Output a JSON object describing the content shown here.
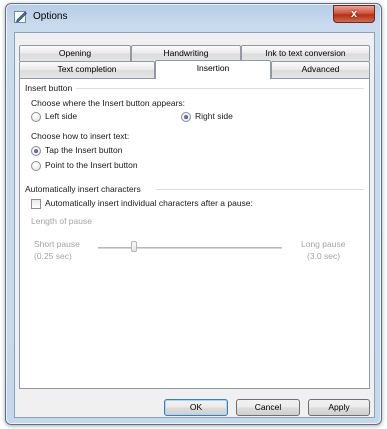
{
  "window": {
    "title": "Options",
    "close_glyph": "x"
  },
  "tabs": {
    "row_top": [
      "Opening",
      "Handwriting",
      "Ink to text conversion"
    ],
    "row_bottom": [
      "Text completion",
      "Insertion",
      "Advanced"
    ],
    "selected": "Insertion"
  },
  "insert_button": {
    "group_label": "Insert button",
    "where_prompt": "Choose where the Insert button appears:",
    "left_side": {
      "label": "Left side",
      "checked": false
    },
    "right_side": {
      "label": "Right side",
      "checked": true
    },
    "how_prompt": "Choose how to insert text:",
    "tap": {
      "label": "Tap the Insert button",
      "checked": true
    },
    "point": {
      "label": "Point to the Insert button",
      "checked": false
    }
  },
  "auto_insert": {
    "group_label": "Automatically insert characters",
    "checkbox_label": "Automatically insert individual characters after a pause:",
    "checked": false,
    "length_label": "Length of pause",
    "short_label": "Short pause",
    "short_value": "(0.25 sec)",
    "long_label": "Long pause",
    "long_value": "(3.0 sec)"
  },
  "buttons": {
    "ok": "OK",
    "cancel": "Cancel",
    "apply": "Apply"
  },
  "icons": {
    "app": "pen-options-icon",
    "close": "close-icon"
  }
}
